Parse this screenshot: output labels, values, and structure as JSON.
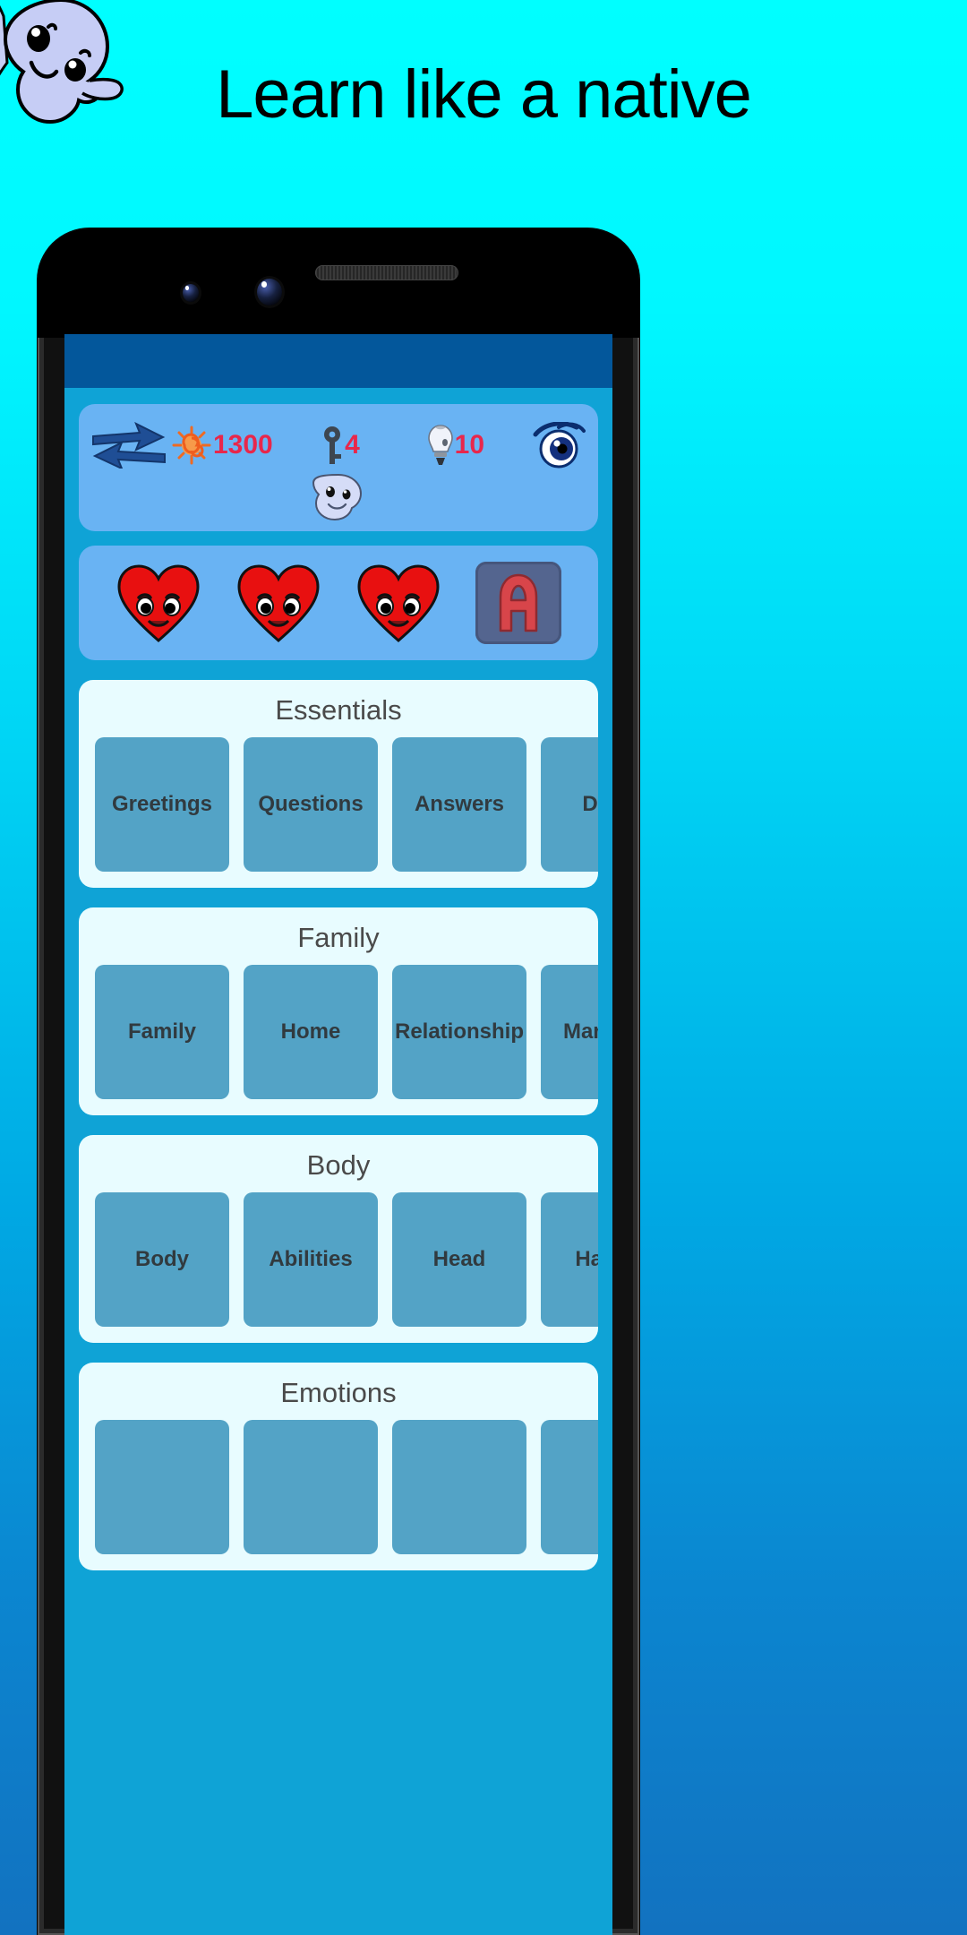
{
  "headline": "Learn like a native",
  "mascot": {
    "name": "ghost-mascot"
  },
  "colors": {
    "background_top": "#00ffff",
    "background_bottom": "#1272c0",
    "appbar": "#03579b",
    "screen": "#0fa3d6",
    "stats_card": "#69b3f3",
    "category_card": "#e8fcff",
    "topic_tile": "#53a3c6",
    "stat_value": "#e8274b",
    "heart": "#e81010"
  },
  "app": {
    "stats": [
      {
        "icon": "swap-arrows-icon",
        "value": ""
      },
      {
        "icon": "sun-icon",
        "value": "1300"
      },
      {
        "icon": "key-icon",
        "value": "4"
      },
      {
        "icon": "lightbulb-icon",
        "value": "10"
      },
      {
        "icon": "eye-icon",
        "value": ""
      }
    ],
    "lives": {
      "icon": "heart-face-icon",
      "count": 3
    },
    "letter_tile": {
      "icon": "letter-a-tile",
      "label": "A"
    },
    "categories": [
      {
        "title": "Essentials",
        "topics": [
          "Greetings",
          "Questions",
          "Answers",
          "Days"
        ]
      },
      {
        "title": "Family",
        "topics": [
          "Family",
          "Home",
          "Relationship",
          "Marriage"
        ]
      },
      {
        "title": "Body",
        "topics": [
          "Body",
          "Abilities",
          "Head",
          "Hands"
        ]
      },
      {
        "title": "Emotions",
        "topics": [
          "",
          "",
          "",
          ""
        ]
      }
    ]
  }
}
